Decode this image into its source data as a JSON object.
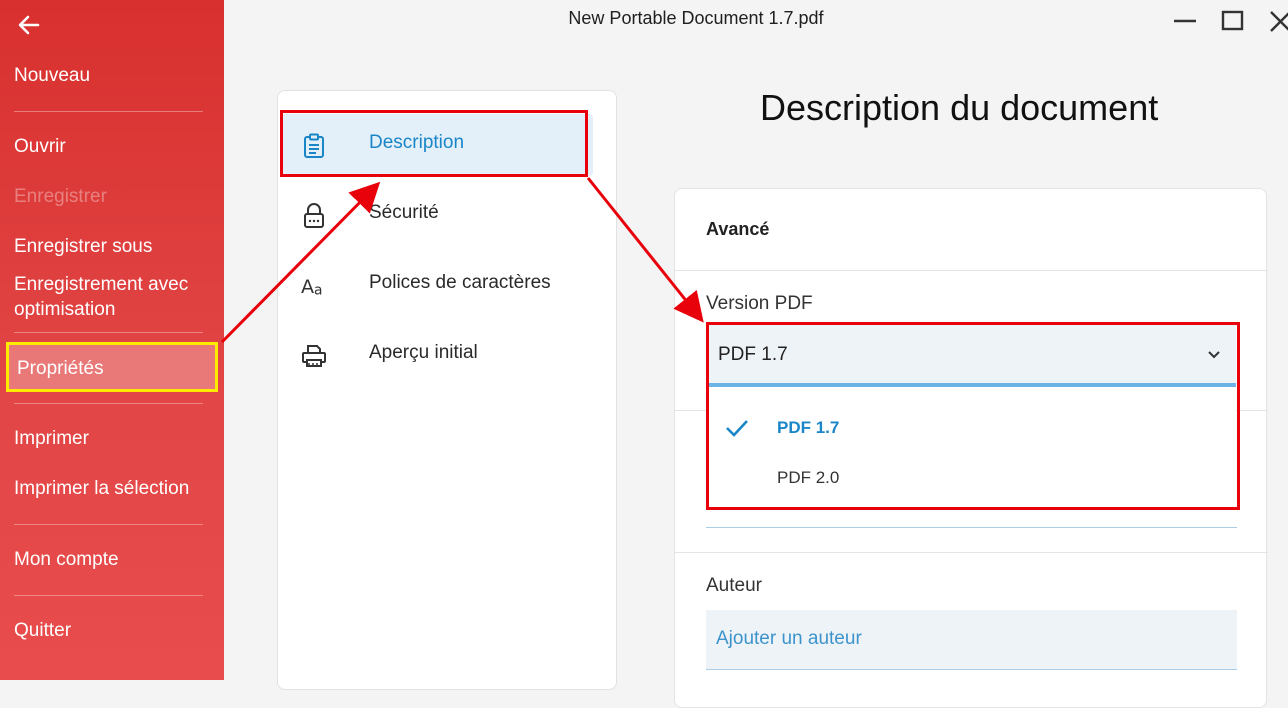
{
  "window": {
    "title": "New Portable Document 1.7.pdf",
    "controls": [
      "minimize-icon",
      "maximize-icon",
      "close-icon"
    ]
  },
  "sidebar": {
    "back_icon": "arrow-left-icon",
    "items": [
      {
        "label": "Nouveau",
        "state": "normal"
      },
      {
        "label": "Ouvrir",
        "state": "normal"
      },
      {
        "label": "Enregistrer",
        "state": "disabled"
      },
      {
        "label": "Enregistrer sous",
        "state": "normal"
      },
      {
        "label": "Enregistrement avec optimisation",
        "state": "normal"
      },
      {
        "label": "Propriétés",
        "state": "selected"
      },
      {
        "label": "Imprimer",
        "state": "normal"
      },
      {
        "label": "Imprimer la sélection",
        "state": "normal"
      },
      {
        "label": "Mon compte",
        "state": "normal"
      },
      {
        "label": "Quitter",
        "state": "normal"
      }
    ],
    "colors": {
      "background": "#e14545",
      "highlight_border": "#ffeb00"
    }
  },
  "nav": {
    "items": [
      {
        "label": "Description",
        "icon": "clipboard-icon",
        "active": true
      },
      {
        "label": "Sécurité",
        "icon": "lock-icon",
        "active": false
      },
      {
        "label": "Polices de caractères",
        "icon": "font-icon",
        "active": false
      },
      {
        "label": "Aperçu initial",
        "icon": "printer-icon",
        "active": false
      }
    ]
  },
  "main": {
    "title": "Description du document",
    "section_title": "Avancé",
    "pdf_version": {
      "label": "Version PDF",
      "value": "PDF 1.7",
      "options": [
        {
          "label": "PDF 1.7",
          "selected": true
        },
        {
          "label": "PDF 2.0",
          "selected": false
        }
      ]
    },
    "author": {
      "label": "Auteur",
      "placeholder": "Ajouter un auteur"
    }
  },
  "colors": {
    "accent": "#1a86c8",
    "annotation": "#e8000b"
  }
}
